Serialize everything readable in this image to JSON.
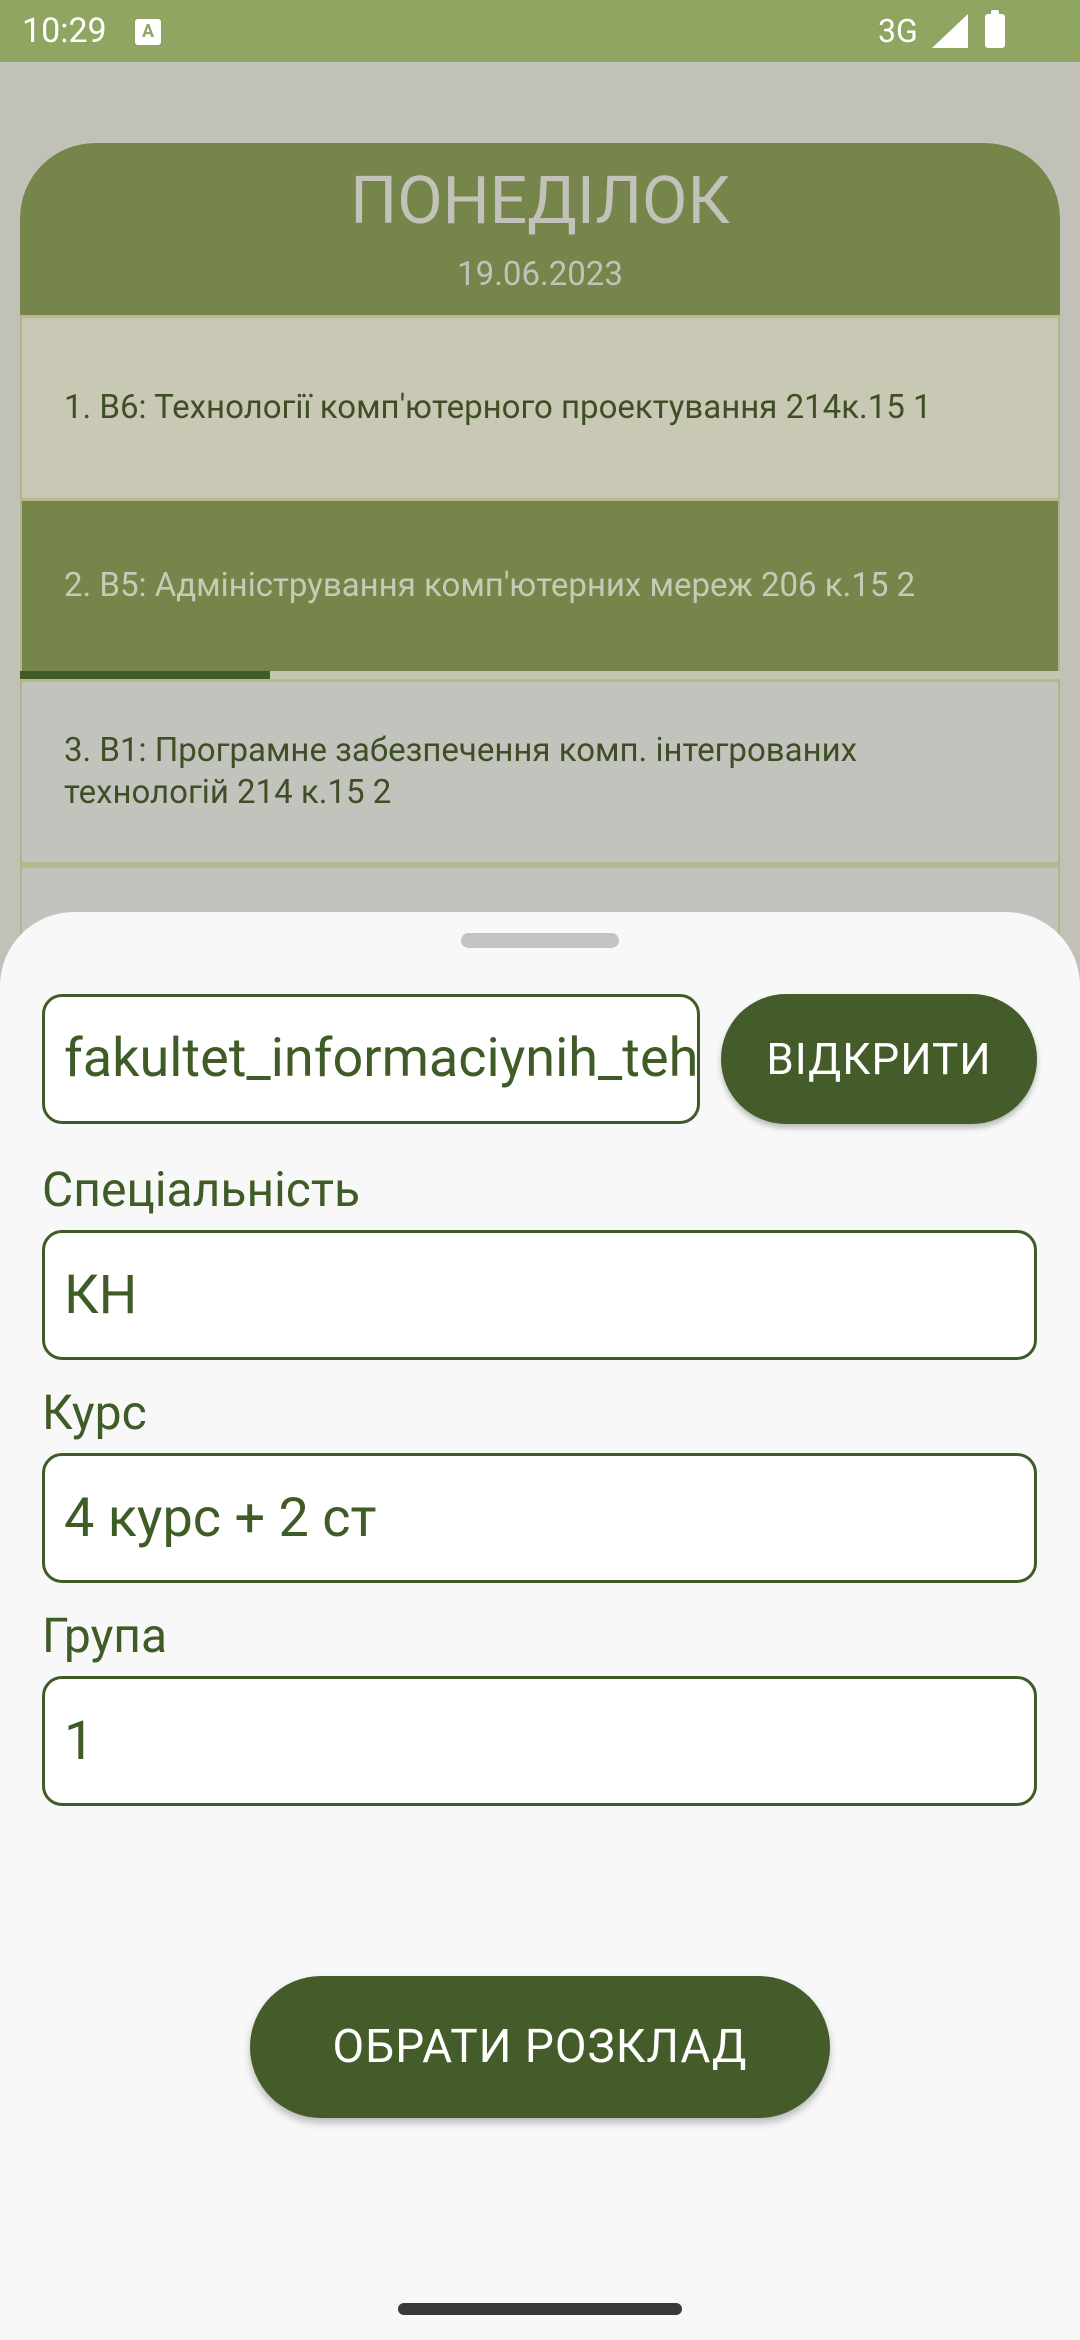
{
  "status_bar": {
    "time": "10:29",
    "notification_icon": "A",
    "network": "3G",
    "icons": [
      "signal-icon",
      "battery-icon"
    ]
  },
  "schedule": {
    "day": "ПОНЕДІЛОК",
    "date": "19.06.2023",
    "lessons": [
      {
        "text": "1. В6: Технології комп'ютерного проектування 214к.15 1"
      },
      {
        "text": "2. В5: Адміністрування комп'ютерних мереж 206 к.15 2",
        "active": true,
        "progress": 0.24
      },
      {
        "text": "3. В1: Програмне забезпечення комп. інтегрованих технологій 214 к.15 2"
      }
    ]
  },
  "sheet": {
    "url_value": "fakultet_informaciynih_tehnologiy",
    "open_button": "ВІДКРИТИ",
    "specialty_label": "Спеціальність",
    "specialty_value": "КН",
    "course_label": "Курс",
    "course_value": "4 курс + 2 ст",
    "group_label": "Група",
    "group_value": "1",
    "choose_button": "ОБРАТИ РОЗКЛАД"
  },
  "colors": {
    "status_bar": "#91a563",
    "header": "#76864a",
    "primary": "#445c29",
    "sheet_background": "#f8f8f8"
  }
}
